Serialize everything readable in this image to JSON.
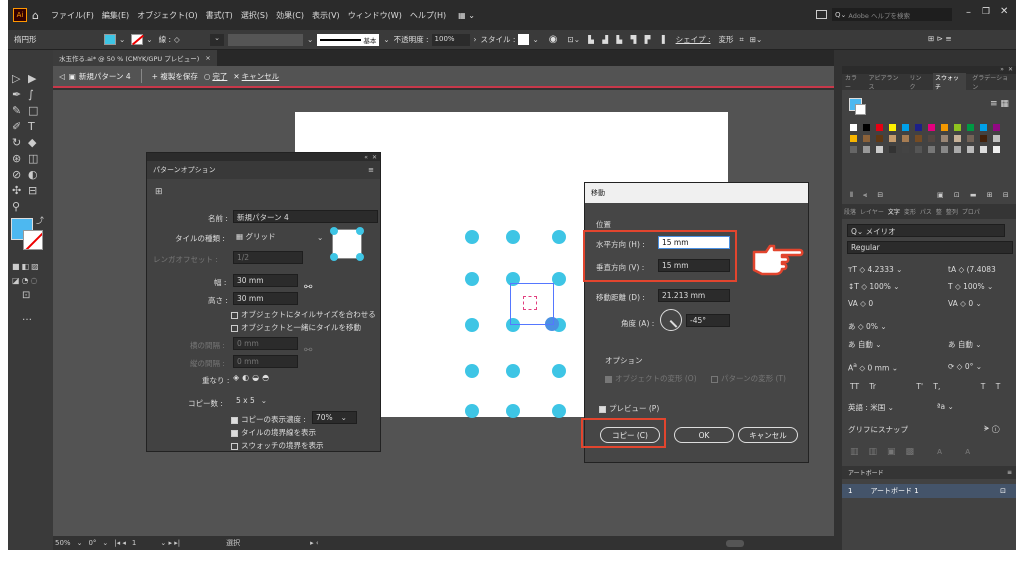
{
  "menubar": {
    "app_icon": "Ai",
    "items": [
      "ファイル(F)",
      "編集(E)",
      "オブジェクト(O)",
      "書式(T)",
      "選択(S)",
      "効果(C)",
      "表示(V)",
      "ウィンドウ(W)",
      "ヘルプ(H)"
    ],
    "search_placeholder": "Adobe ヘルプを検索"
  },
  "controlbar": {
    "selection_label": "楕円形",
    "stroke_label": "線 :",
    "stroke_style": "基本",
    "opacity_label": "不透明度 :",
    "opacity_value": "100%",
    "style_label": "スタイル :",
    "shape_label": "シェイプ :",
    "transform_label": "変形"
  },
  "document": {
    "tab_title": "水玉作る.ai* @ 50 % (CMYK/GPU プレビュー)",
    "close": "×"
  },
  "pattern_bar": {
    "pattern_name": "新規パターン 4",
    "save_copy": "+ 複製を保存",
    "done": "完了",
    "cancel": "キャンセル"
  },
  "pattern_options": {
    "title": "パターンオプション",
    "name_label": "名前 :",
    "name_value": "新規パターン 4",
    "tile_type_label": "タイルの種類 :",
    "tile_type_value": "グリッド",
    "brick_offset_label": "レンガオフセット :",
    "brick_offset_value": "1/2",
    "width_label": "幅 :",
    "width_value": "30 mm",
    "height_label": "高さ :",
    "height_value": "30 mm",
    "fit_tile": "オブジェクトにタイルサイズを合わせる",
    "move_tile": "オブジェクトと一緒にタイルを移動",
    "h_spacing_label": "横の間隔 :",
    "h_spacing_value": "0 mm",
    "v_spacing_label": "縦の間隔 :",
    "v_spacing_value": "0 mm",
    "overlap_label": "重なり :",
    "copies_label": "コピー数 :",
    "copies_value": "5 x 5",
    "dim_copies": "コピーの表示濃度 :",
    "dim_value": "70%",
    "show_tile_edge": "タイルの境界線を表示",
    "show_swatch_bounds": "スウォッチの境界を表示"
  },
  "move_dialog": {
    "title": "移動",
    "position_section": "位置",
    "horizontal_label": "水平方向 (H) :",
    "horizontal_value": "15 mm",
    "vertical_label": "垂直方向 (V) :",
    "vertical_value": "15 mm",
    "distance_label": "移動距離 (D) :",
    "distance_value": "21.213 mm",
    "angle_label": "角度 (A) :",
    "angle_value": "-45°",
    "options_section": "オプション",
    "transform_objects": "オブジェクトの変形 (O)",
    "transform_patterns": "パターンの変形 (T)",
    "preview": "プレビュー (P)",
    "copy_button": "コピー (C)",
    "ok_button": "OK",
    "cancel_button": "キャンセル"
  },
  "right_panel": {
    "tabs": [
      "カラー",
      "アピアランス",
      "リンク",
      "スウォッチ",
      "グラデーション"
    ],
    "char_tabs": [
      "段落",
      "レイヤー",
      "文字",
      "変形",
      "パス",
      "整",
      "整列",
      "プロパ"
    ],
    "font_family": "メイリオ",
    "font_style": "Regular",
    "font_size": "4.2333",
    "leading": "(7.4083",
    "vscale": "100%",
    "hscale": "100%",
    "tracking": "0",
    "kerning": "0",
    "tsume": "0%",
    "aki_left": "自動",
    "aki_right": "自動",
    "baseline": "0 mm",
    "rotation": "0°",
    "tt1": "TT",
    "tt2": "Tr",
    "tt3": "T'",
    "tt4": "T,",
    "tt5": "T",
    "tt6": "T",
    "language": "英語 : 米国",
    "aa": "ªa",
    "glyph_snap": "グリフにスナップ",
    "artboards_tab": "アートボード",
    "artboard_index": "1",
    "artboard_name": "アートボード 1"
  },
  "status": {
    "zoom": "50%",
    "rotation": "0°",
    "page": "1",
    "tool": "選択"
  },
  "colors": {
    "dot": "#3ec5e5",
    "highlight": "#e2452e",
    "pattern_bar_border": "#c8384a"
  }
}
